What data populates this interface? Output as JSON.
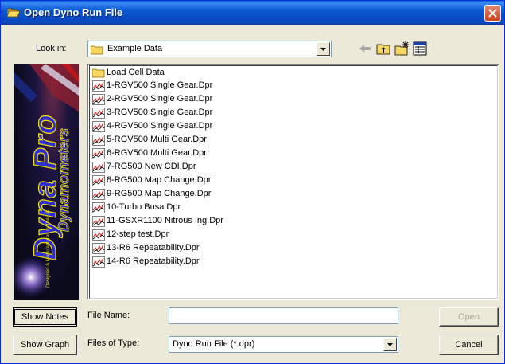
{
  "window": {
    "title": "Open Dyno Run File"
  },
  "look_in": {
    "label": "Look in:",
    "value": "Example Data"
  },
  "files": [
    {
      "name": "Load Cell Data",
      "type": "folder"
    },
    {
      "name": "1-RGV500 Single Gear.Dpr",
      "type": "file"
    },
    {
      "name": "2-RGV500 Single Gear.Dpr",
      "type": "file"
    },
    {
      "name": "3-RGV500 Single Gear.Dpr",
      "type": "file"
    },
    {
      "name": "4-RGV500 Single Gear.Dpr",
      "type": "file"
    },
    {
      "name": "5-RGV500 Multi Gear.Dpr",
      "type": "file"
    },
    {
      "name": "6-RGV500 Multi Gear.Dpr",
      "type": "file"
    },
    {
      "name": "7-RG500 New CDI.Dpr",
      "type": "file"
    },
    {
      "name": "8-RG500 Map Change.Dpr",
      "type": "file"
    },
    {
      "name": "9-RG500 Map Change.Dpr",
      "type": "file"
    },
    {
      "name": "10-Turbo Busa.Dpr",
      "type": "file"
    },
    {
      "name": "11-GSXR1100 Nitrous Ing.Dpr",
      "type": "file"
    },
    {
      "name": "12-step test.Dpr",
      "type": "file"
    },
    {
      "name": "13-R6 Repeatability.Dpr",
      "type": "file"
    },
    {
      "name": "14-R6 Repeatability.Dpr",
      "type": "file"
    }
  ],
  "splash": {
    "line1": "Dyna Pro",
    "line2": "Dynamometers",
    "line3": "Designed & Manufactured in The UK"
  },
  "buttons": {
    "show_notes": "Show Notes",
    "show_graph": "Show Graph",
    "open": "Open",
    "cancel": "Cancel"
  },
  "file_name": {
    "label": "File Name:",
    "value": ""
  },
  "files_of_type": {
    "label": "Files of Type:",
    "value": "Dyno Run File (*.dpr)"
  },
  "colors": {
    "titlebar": "#0a58d0",
    "close": "#c8431e",
    "splash_text": "#2b2bd8",
    "splash_outline": "#f2e000"
  },
  "icons": {
    "title": "open-folder-icon",
    "back": "back-arrow-icon",
    "up": "up-folder-icon",
    "new_folder": "new-folder-icon",
    "view": "view-menu-icon"
  }
}
